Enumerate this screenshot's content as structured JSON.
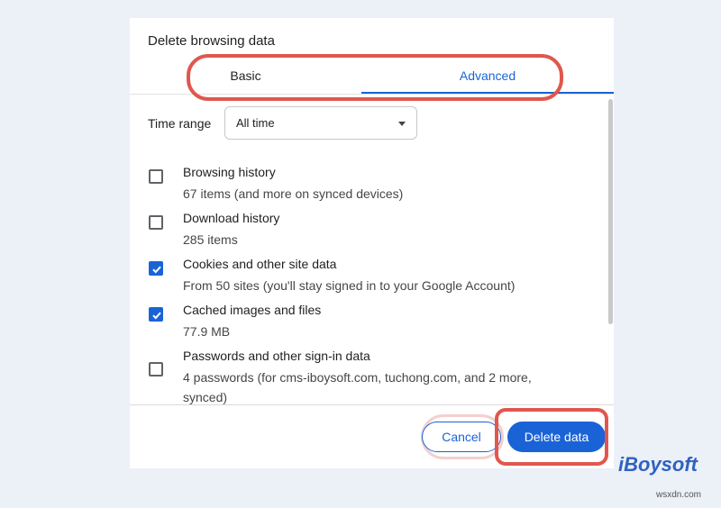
{
  "dialog": {
    "title": "Delete browsing data",
    "tabs": [
      {
        "label": "Basic",
        "selected": false
      },
      {
        "label": "Advanced",
        "selected": true
      }
    ],
    "time_range": {
      "label": "Time range",
      "selected": "All time"
    },
    "items": [
      {
        "title": "Browsing history",
        "desc": "67 items (and more on synced devices)",
        "checked": false
      },
      {
        "title": "Download history",
        "desc": "285 items",
        "checked": false
      },
      {
        "title": "Cookies and other site data",
        "desc": "From 50 sites (you'll stay signed in to your Google Account)",
        "checked": true
      },
      {
        "title": "Cached images and files",
        "desc": "77.9 MB",
        "checked": true
      },
      {
        "title": "Passwords and other sign-in data",
        "desc": "4 passwords (for cms-iboysoft.com, tuchong.com, and 2 more, synced)",
        "checked": false
      }
    ],
    "buttons": {
      "cancel": "Cancel",
      "delete": "Delete data"
    }
  },
  "brand": "iBoysoft",
  "watermark": "wsxdn.com",
  "colors": {
    "accent": "#1a63d6",
    "highlight": "#e0574e",
    "background": "#ecf0f7"
  }
}
